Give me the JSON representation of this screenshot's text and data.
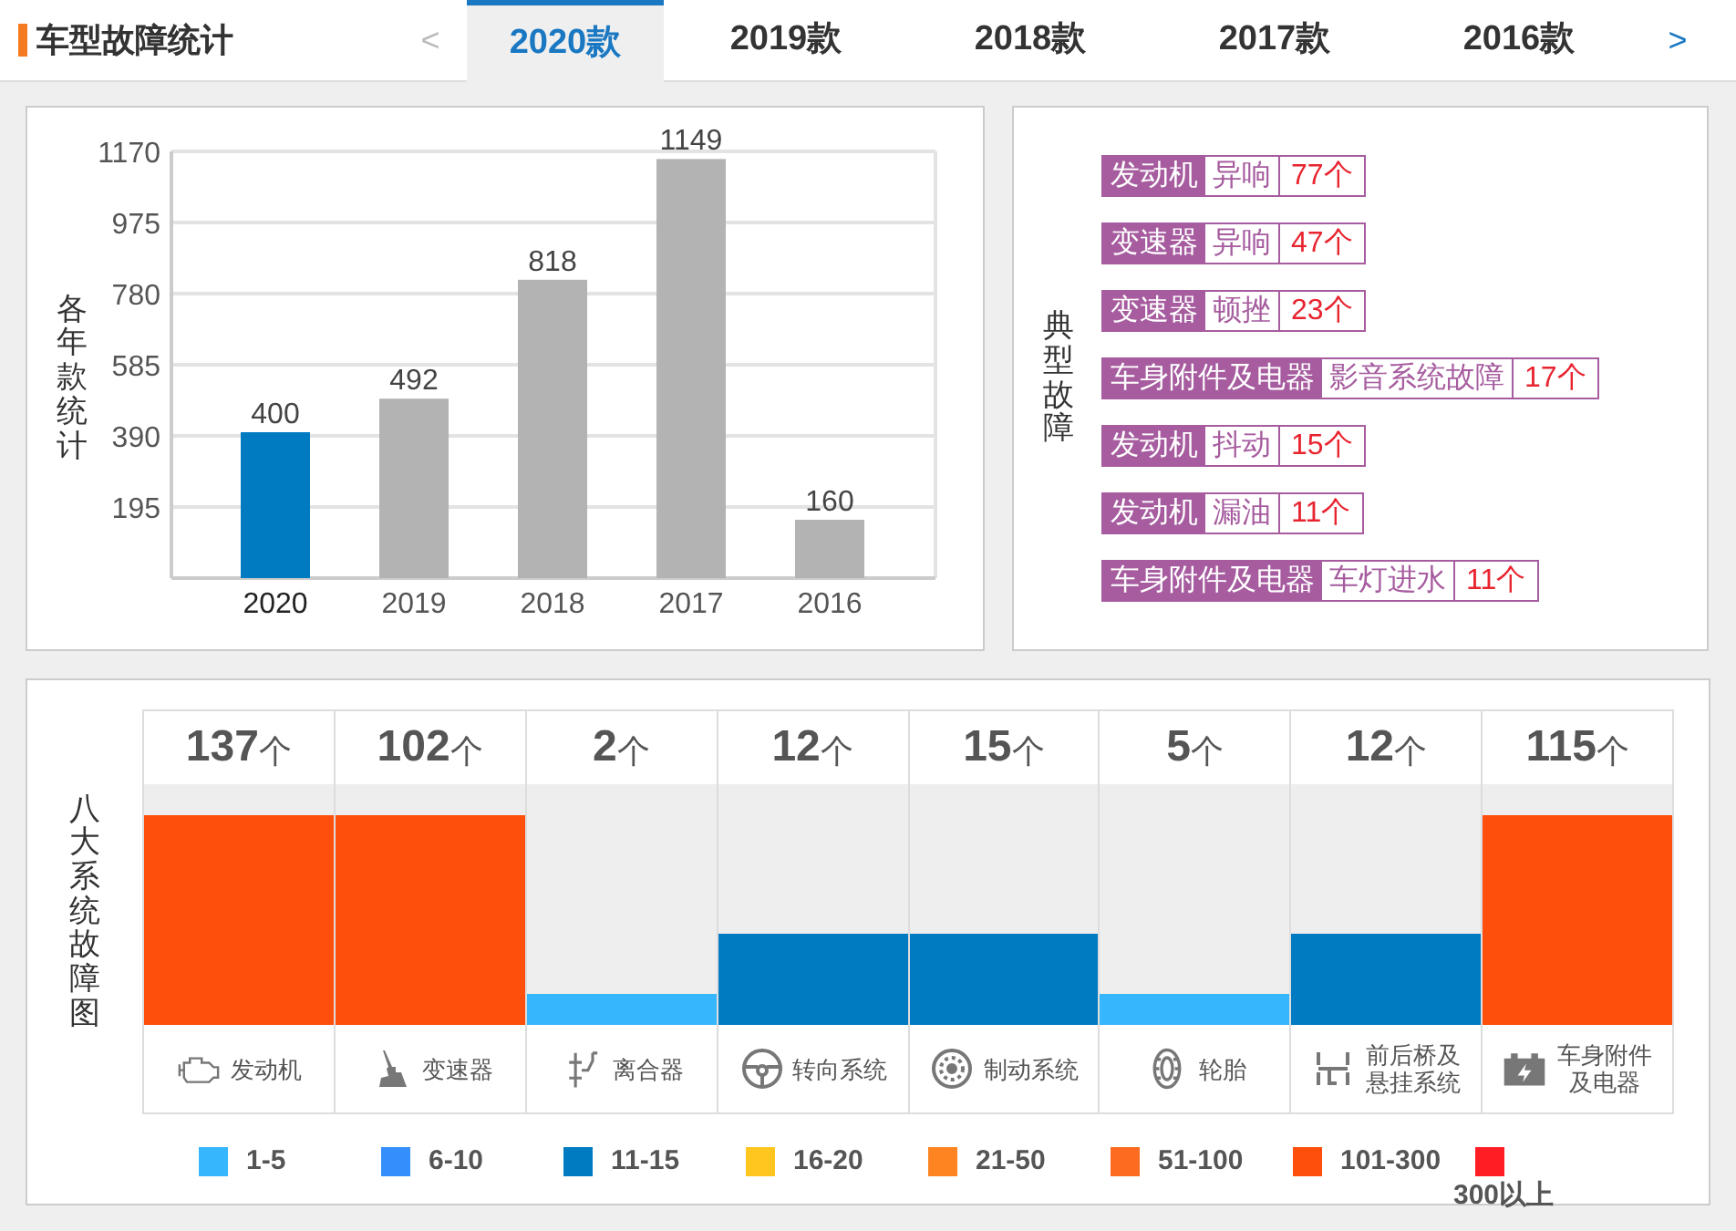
{
  "header": {
    "title": "车型故障统计",
    "prev": "<",
    "next": ">"
  },
  "tabs": [
    {
      "label": "2020款",
      "selected": true
    },
    {
      "label": "2019款",
      "selected": false
    },
    {
      "label": "2018款",
      "selected": false
    },
    {
      "label": "2017款",
      "selected": false
    },
    {
      "label": "2016款",
      "selected": false
    }
  ],
  "yearly_chart": {
    "chart_data": {
      "type": "bar",
      "ylabel": "各年款统计",
      "categories": [
        "2020",
        "2019",
        "2018",
        "2017",
        "2016"
      ],
      "series": [
        {
          "color": "#007bc2",
          "values": [
            400,
            null,
            null,
            null,
            null
          ]
        },
        {
          "color": "#b3b3b3",
          "values": [
            null,
            492,
            818,
            1149,
            160
          ]
        }
      ],
      "stacked": true,
      "grid": true,
      "ylim": [
        0,
        1170
      ],
      "yticks": [
        195,
        390,
        585,
        780,
        975,
        1170
      ],
      "data_labels": true
    }
  },
  "typical_faults": {
    "title": "典型故障",
    "items": [
      {
        "system": "发动机",
        "fault": "异响",
        "count": "77个"
      },
      {
        "system": "变速器",
        "fault": "异响",
        "count": "47个"
      },
      {
        "system": "变速器",
        "fault": "顿挫",
        "count": "23个"
      },
      {
        "system": "车身附件及电器",
        "fault": "影音系统故障",
        "count": "17个"
      },
      {
        "system": "发动机",
        "fault": "抖动",
        "count": "15个"
      },
      {
        "system": "发动机",
        "fault": "漏油",
        "count": "11个"
      },
      {
        "system": "车身附件及电器",
        "fault": "车灯进水",
        "count": "11个"
      }
    ]
  },
  "systems": {
    "title": "八大系统故障图",
    "items": [
      {
        "count": "137",
        "unit": "个",
        "label": "发动机",
        "level": 0.87,
        "color": "#ff4f0c"
      },
      {
        "count": "102",
        "unit": "个",
        "label": "变速器",
        "level": 0.87,
        "color": "#ff4f0c"
      },
      {
        "count": "2",
        "unit": "个",
        "label": "离合器",
        "level": 0.13,
        "color": "#35b6fd"
      },
      {
        "count": "12",
        "unit": "个",
        "label": "转向系统",
        "level": 0.38,
        "color": "#007bc2"
      },
      {
        "count": "15",
        "unit": "个",
        "label": "制动系统",
        "level": 0.38,
        "color": "#007bc2"
      },
      {
        "count": "5",
        "unit": "个",
        "label": "轮胎",
        "level": 0.13,
        "color": "#35b6fd"
      },
      {
        "count": "12",
        "unit": "个",
        "label": "前后桥及悬挂系统",
        "level": 0.38,
        "color": "#007bc2"
      },
      {
        "count": "115",
        "unit": "个",
        "label": "车身附件及电器",
        "level": 0.87,
        "color": "#ff4f0c"
      }
    ]
  },
  "legend": [
    {
      "label": "1-5",
      "color": "#35b6fd"
    },
    {
      "label": "6-10",
      "color": "#348ffd"
    },
    {
      "label": "11-15",
      "color": "#007bc2"
    },
    {
      "label": "16-20",
      "color": "#fec61f"
    },
    {
      "label": "21-50",
      "color": "#fd8421"
    },
    {
      "label": "51-100",
      "color": "#fd6b21"
    },
    {
      "label": "101-300",
      "color": "#ff4f0c"
    },
    {
      "label": "300以上",
      "color": "#fe1e24"
    }
  ]
}
